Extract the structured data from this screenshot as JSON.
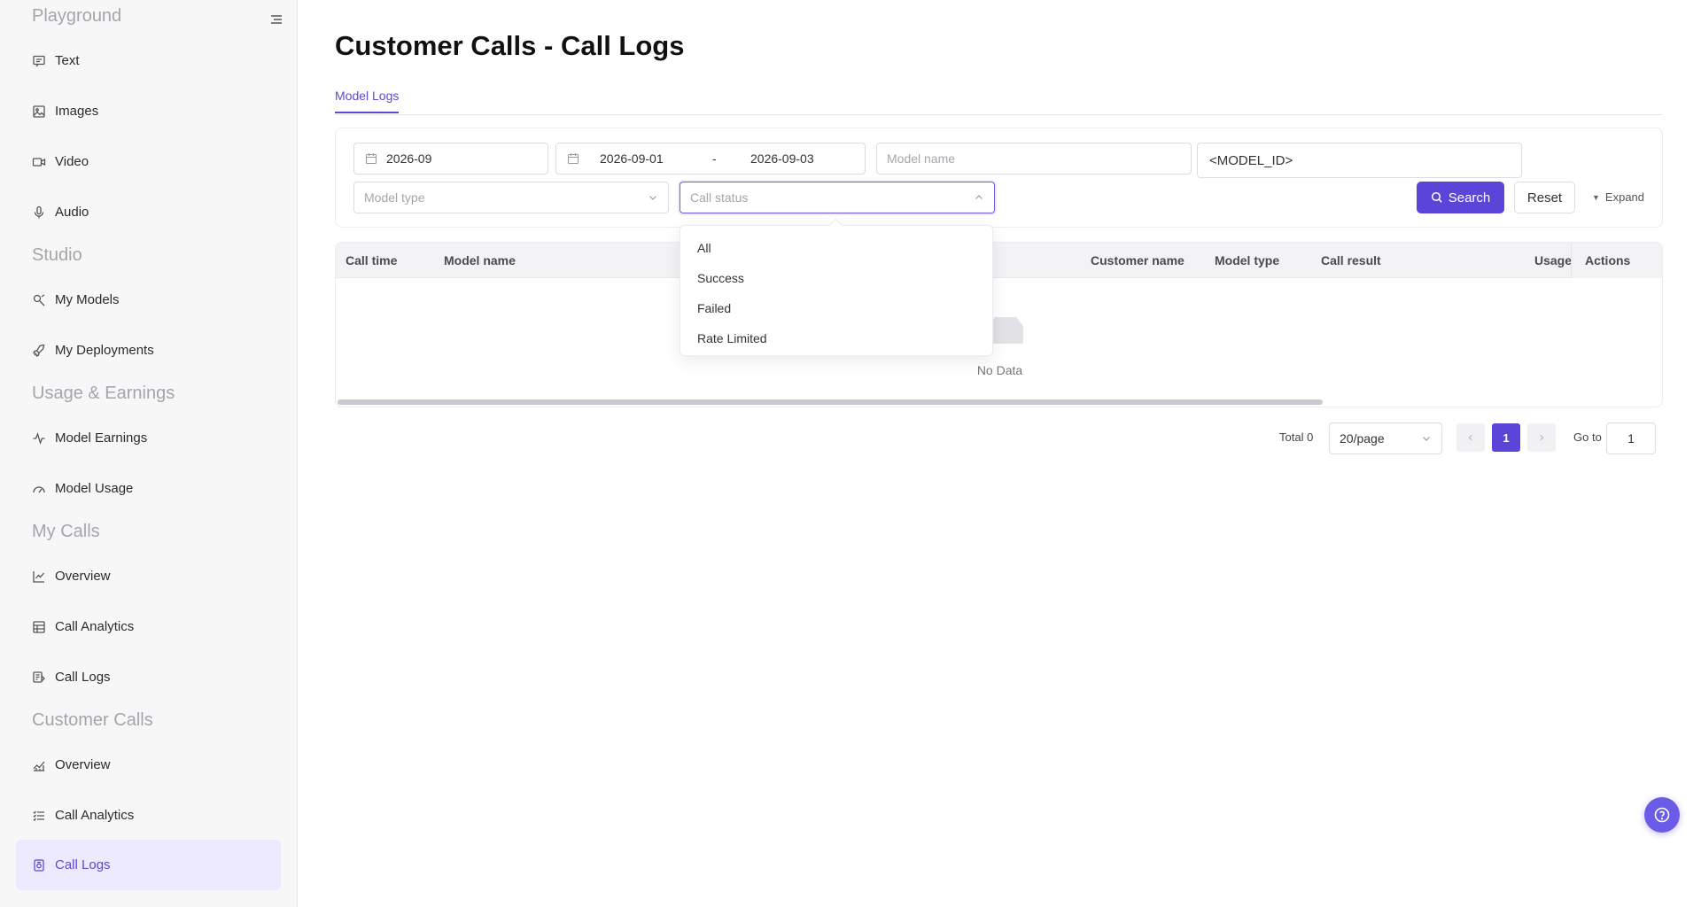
{
  "sidebar": {
    "sections": {
      "playground": "Playground",
      "studio": "Studio",
      "usage": "Usage & Earnings",
      "my_calls": "My Calls",
      "customer_calls": "Customer Calls"
    },
    "items": {
      "text": "Text",
      "images": "Images",
      "video": "Video",
      "audio": "Audio",
      "my_models": "My Models",
      "my_deployments": "My Deployments",
      "model_earnings": "Model Earnings",
      "model_usage": "Model Usage",
      "mc_overview": "Overview",
      "mc_call_analytics": "Call Analytics",
      "mc_call_logs": "Call Logs",
      "cc_overview": "Overview",
      "cc_call_analytics": "Call Analytics",
      "cc_call_logs": "Call Logs"
    }
  },
  "page": {
    "title": "Customer Calls - Call Logs",
    "tab": "Model Logs"
  },
  "filters": {
    "month": "2026-09",
    "range_start": "2026-09-01",
    "range_sep": "-",
    "range_end": "2026-09-03",
    "model_name_placeholder": "Model name",
    "model_id_value": "<MODEL_ID>",
    "model_type_placeholder": "Model type",
    "call_status_placeholder": "Call status",
    "search_label": "Search",
    "reset_label": "Reset",
    "expand_label": "Expand"
  },
  "table": {
    "columns": {
      "call_time": "Call time",
      "model_name": "Model name",
      "customer_name": "Customer name",
      "model_type": "Model type",
      "call_result": "Call result",
      "usage": "Usage",
      "actions": "Actions"
    },
    "empty": "No Data"
  },
  "pagination": {
    "total": "Total 0",
    "page_size": "20/page",
    "current": "1",
    "goto_label": "Go to",
    "goto_value": "1"
  },
  "dropdown": {
    "options": [
      "All",
      "Success",
      "Failed",
      "Rate Limited"
    ]
  },
  "colors": {
    "accent": "#5b45d9",
    "active_bg": "#ede9fe"
  }
}
